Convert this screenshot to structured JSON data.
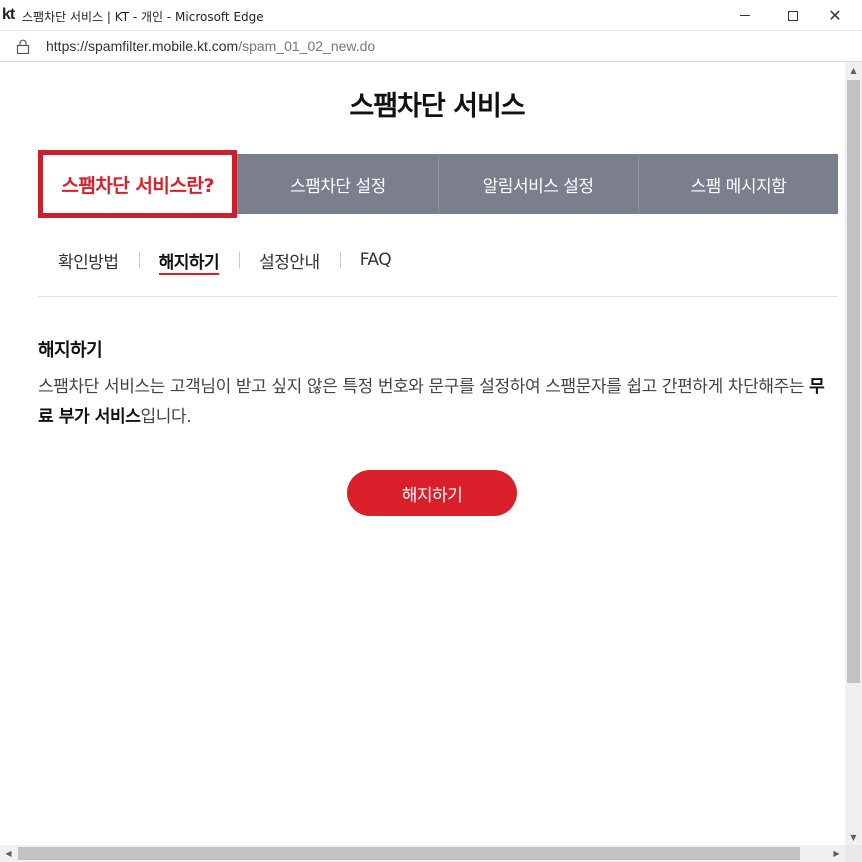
{
  "window": {
    "logo": "kt",
    "title": "스팸차단 서비스 | KT - 개인 - Microsoft Edge",
    "minimize_icon": "minimize-icon",
    "maximize_icon": "maximize-icon",
    "close_icon": "close-icon"
  },
  "address": {
    "lock_icon": "lock-icon",
    "host": "https://spamfilter.mobile.kt.com",
    "path": "/spam_01_02_new.do"
  },
  "page": {
    "title": "스팸차단 서비스"
  },
  "tabs": [
    {
      "label": "스팸차단 서비스란?",
      "active": true
    },
    {
      "label": "스팸차단 설정",
      "active": false
    },
    {
      "label": "알림서비스 설정",
      "active": false
    },
    {
      "label": "스팸 메시지함",
      "active": false
    }
  ],
  "subtabs": [
    {
      "label": "확인방법",
      "active": false
    },
    {
      "label": "해지하기",
      "active": true
    },
    {
      "label": "설정안내",
      "active": false
    },
    {
      "label": "FAQ",
      "active": false
    }
  ],
  "content": {
    "section_title": "해지하기",
    "desc_part1": "스팸차단 서비스는 고객님이 받고 싶지 않은 특정 번호와 문구를 설정하여 스팸문자를 쉽고 간편하게 차단해주는 ",
    "desc_bold": "무료 부가 서비스",
    "desc_part2": "입니다.",
    "button_label": "해지하기"
  },
  "colors": {
    "accent": "#d81f2a",
    "tab_bg": "#7b7e8c"
  }
}
